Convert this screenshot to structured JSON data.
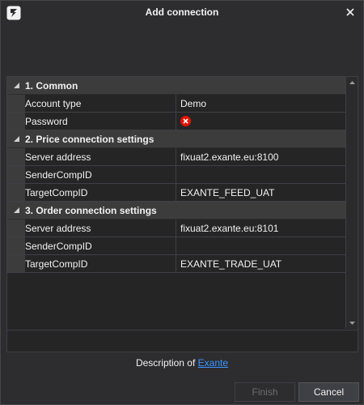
{
  "window": {
    "title": "Add connection"
  },
  "grid": {
    "sections": [
      {
        "label": "1. Common",
        "rows": [
          {
            "name": "Account type",
            "value": "Demo"
          },
          {
            "name": "Password",
            "value": ""
          }
        ]
      },
      {
        "label": "2. Price connection settings",
        "rows": [
          {
            "name": "Server address",
            "value": "fixuat2.exante.eu:8100"
          },
          {
            "name": "SenderCompID",
            "value": ""
          },
          {
            "name": "TargetCompID",
            "value": "EXANTE_FEED_UAT"
          }
        ]
      },
      {
        "label": "3. Order connection settings",
        "rows": [
          {
            "name": "Server address",
            "value": "fixuat2.exante.eu:8101"
          },
          {
            "name": "SenderCompID",
            "value": ""
          },
          {
            "name": "TargetCompID",
            "value": "EXANTE_TRADE_UAT"
          }
        ]
      }
    ]
  },
  "description": {
    "prefix": "Description of",
    "link": "Exante"
  },
  "buttons": {
    "finish": "Finish",
    "cancel": "Cancel"
  },
  "icons": {
    "app": "app-logo-icon",
    "close": "close-icon",
    "password_status": "error-icon",
    "collapse": "triangle-collapse-icon"
  },
  "colors": {
    "background": "#2d2d30",
    "error": "#e51400",
    "link": "#3794ff"
  }
}
